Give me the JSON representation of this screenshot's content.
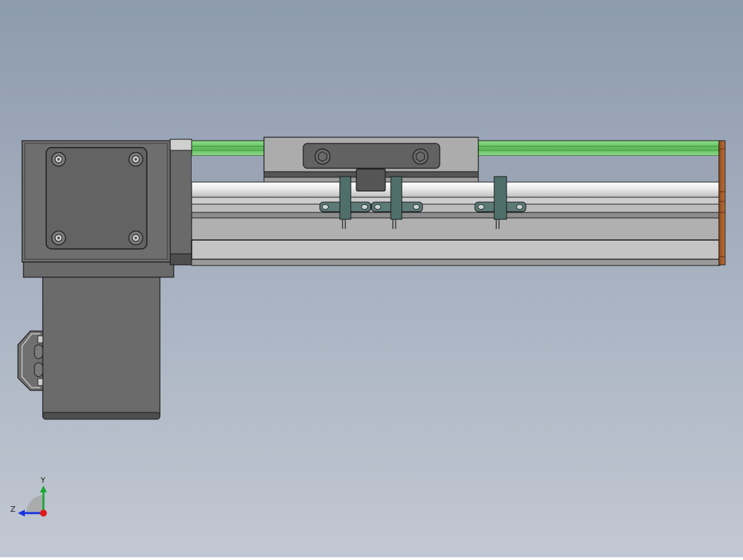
{
  "scene": {
    "background_top": "#8d9bae",
    "background_bottom": "#c2c8d3"
  },
  "triad": {
    "y_label": "Y",
    "z_label": "Z",
    "y_color": "#1aa832",
    "z_color": "#1733e0",
    "x_color": "#e01818"
  },
  "colors": {
    "body_gray": "#6f6f6f",
    "body_dark": "#4a4a4a",
    "rail_light": "#f2f2f2",
    "belt_green": "#7fcf7a",
    "end_cap_brown": "#b5652c",
    "sensor_teal": "#4f6f6a",
    "outline": "#1a1a1a"
  }
}
